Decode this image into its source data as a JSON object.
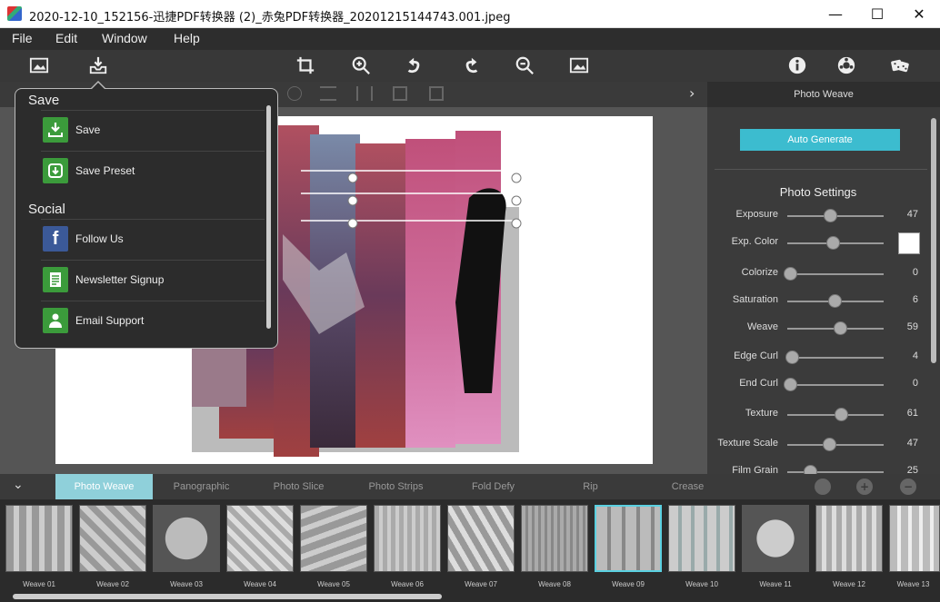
{
  "window": {
    "title": "2020-12-10_152156-迅捷PDF转换器 (2)_赤兔PDF转换器_20201215144743.001.jpeg",
    "minimize": "—",
    "maximize": "☐",
    "close": "✕"
  },
  "menu": [
    "File",
    "Edit",
    "Window",
    "Help"
  ],
  "toolbar_icons": [
    "image-icon",
    "save-tray-icon",
    "crop-icon",
    "zoom-in-icon",
    "undo-icon",
    "redo-icon",
    "zoom-out-icon",
    "fit-image-icon",
    "info-icon",
    "settings-icon",
    "dice-icon"
  ],
  "save_menu": {
    "save_header": "Save",
    "save_items": [
      {
        "label": "Save",
        "icon": "download-icon",
        "color": "#3b9b3b"
      },
      {
        "label": "Save Preset",
        "icon": "preset-icon",
        "color": "#3b9b3b"
      }
    ],
    "social_header": "Social",
    "social_items": [
      {
        "label": "Follow Us",
        "icon": "facebook-icon",
        "color": "#3b5998"
      },
      {
        "label": "Newsletter Signup",
        "icon": "newsletter-icon",
        "color": "#3b9b3b"
      },
      {
        "label": "Email Support",
        "icon": "person-icon",
        "color": "#3b9b3b"
      }
    ]
  },
  "right_panel": {
    "header": "Photo Weave",
    "auto_generate": "Auto Generate",
    "section_title": "Photo Settings",
    "sliders": [
      {
        "label": "Exposure",
        "value": "47",
        "level": 0.47
      },
      {
        "label": "Exp. Color",
        "value": "",
        "level": 0.5
      },
      {
        "label": "Colorize",
        "value": "0",
        "level": 0.0
      },
      {
        "label": "Saturation",
        "value": "6",
        "level": 0.5
      },
      {
        "label": "Weave",
        "value": "59",
        "level": 0.59
      },
      {
        "label": "Edge Curl",
        "value": "4",
        "level": 0.04
      },
      {
        "label": "End Curl",
        "value": "0",
        "level": 0.0
      },
      {
        "label": "Texture",
        "value": "61",
        "level": 0.61
      },
      {
        "label": "Texture Scale",
        "value": "47",
        "level": 0.47
      },
      {
        "label": "Film Grain",
        "value": "25",
        "level": 0.25
      }
    ]
  },
  "tabs": [
    "Photo Weave",
    "Panographic",
    "Photo Slice",
    "Photo Strips",
    "Fold Defy",
    "Rip",
    "Crease"
  ],
  "active_tab": "Photo Weave",
  "thumbnails": [
    "Weave 01",
    "Weave 02",
    "Weave 03",
    "Weave 04",
    "Weave 05",
    "Weave 06",
    "Weave 07",
    "Weave 08",
    "Weave 09",
    "Weave 10",
    "Weave 11",
    "Weave 12",
    "Weave 13"
  ],
  "selected_thumbnail": "Weave 09",
  "colors": {
    "accent": "#3cbccf",
    "active_tab": "#8fd0da",
    "panel": "#3b3b3b"
  }
}
